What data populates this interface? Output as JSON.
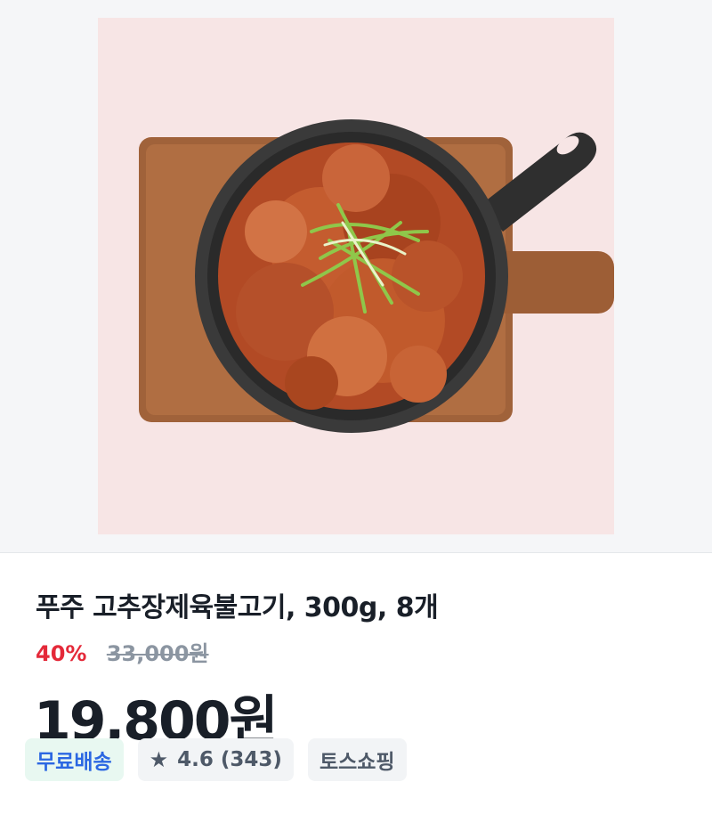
{
  "product": {
    "image_alt": "food-photo",
    "title": "푸주 고추장제육불고기, 300g, 8개",
    "discount_rate": "40%",
    "original_price": "33,000원",
    "price": "19,800원"
  },
  "chips": {
    "shipping": "무료배송",
    "rating_icon": "star-icon",
    "rating": "4.6",
    "review_count": "(343)",
    "store": "토스쇼핑"
  },
  "colors": {
    "discount": "#e42939",
    "shipping_text": "#2b67e2",
    "shipping_bg": "#e8f8f1",
    "chip_bg": "#f2f4f6",
    "title": "#191f28"
  }
}
